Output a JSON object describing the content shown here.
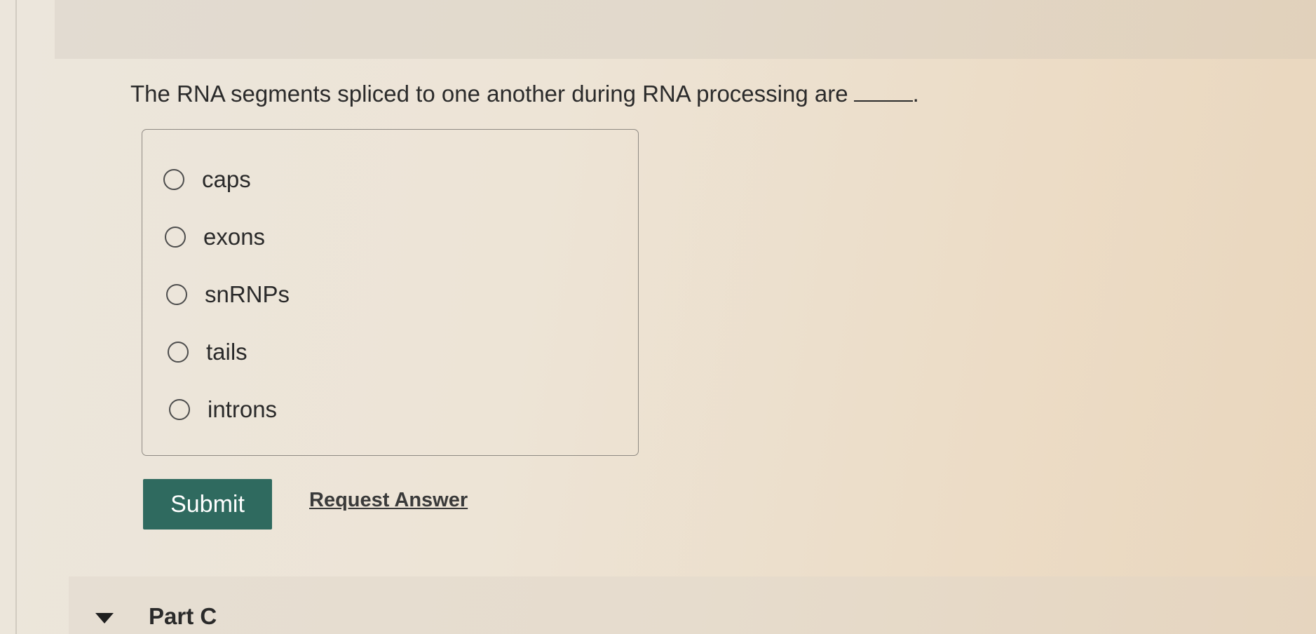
{
  "question": {
    "prompt": "The RNA segments spliced to one another during RNA processing are",
    "terminal_punctuation": "."
  },
  "options": [
    {
      "label": "caps",
      "selected": false
    },
    {
      "label": "exons",
      "selected": false
    },
    {
      "label": "snRNPs",
      "selected": false
    },
    {
      "label": "tails",
      "selected": false
    },
    {
      "label": "introns",
      "selected": false
    }
  ],
  "actions": {
    "submit_label": "Submit",
    "request_answer_label": "Request Answer"
  },
  "next_part": {
    "title": "Part C",
    "toggle_icon": "triangle-down-icon"
  },
  "colors": {
    "submit_button": "#2f6a5f",
    "text": "#2a2a2a"
  }
}
